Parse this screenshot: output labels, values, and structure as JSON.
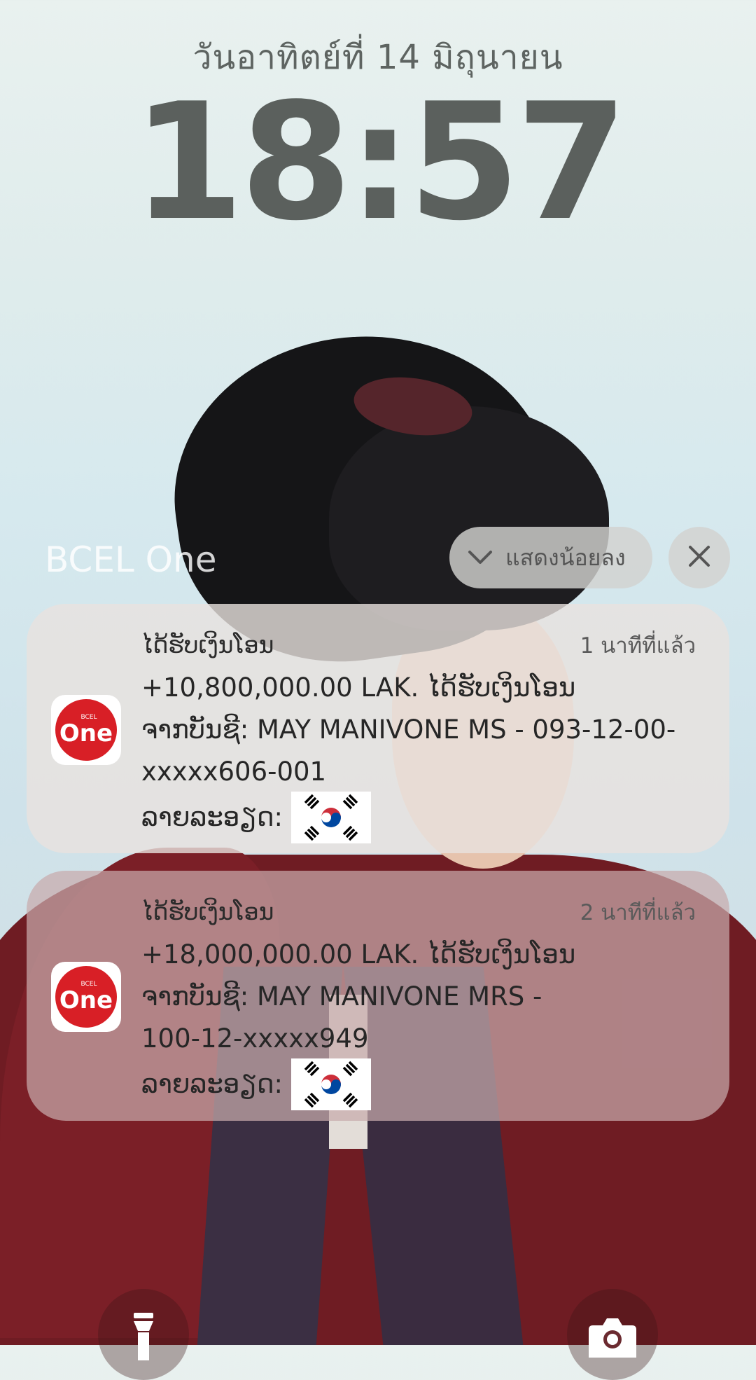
{
  "lockscreen": {
    "date": "วันอาทิตย์ที่ 14 มิถุนายน",
    "time": "18:57"
  },
  "group": {
    "app_name": "BCEL One",
    "show_less_label": "แสดงน้อยลง"
  },
  "notifications": [
    {
      "title": "ໄດ້ຮັບເງິນໂອນ",
      "time_ago": "1 นาทีที่แล้ว",
      "line1": "+10,800,000.00 LAK. ໄດ້ຮັບເງິນໂອນ",
      "line2": "ຈາກບັນຊີ: MAY MANIVONE MS - 093-12-00-",
      "line3": "xxxxx606-001",
      "detail_label": "ລາຍລະອຽດ:"
    },
    {
      "title": "ໄດ້ຮັບເງິນໂອນ",
      "time_ago": "2 นาทีที่แล้ว",
      "line1": "+18,000,000.00 LAK. ໄດ້ຮັບເງິນໂອນ",
      "line2": "ຈາກບັນຊີ: MAY MANIVONE MRS -",
      "line3": "100-12-xxxxx949",
      "detail_label": "ລາຍລະອຽດ:"
    }
  ],
  "icons": {
    "app_icon": "bcel-one-logo-icon",
    "chevron": "chevron-down-icon",
    "close": "close-icon",
    "flag": "korea-flag-icon",
    "flashlight": "flashlight-icon",
    "camera": "camera-icon"
  },
  "colors": {
    "brand_red": "#d81f26"
  }
}
